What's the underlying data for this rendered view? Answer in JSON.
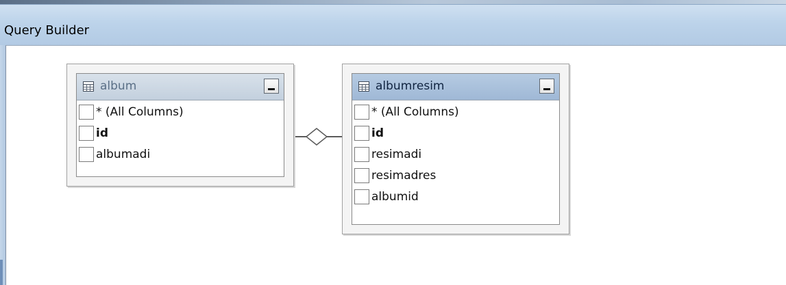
{
  "window": {
    "title": "Query Builder"
  },
  "tables": [
    {
      "name": "album",
      "active": false,
      "columns": [
        {
          "label": "* (All Columns)",
          "key": false,
          "checked": false
        },
        {
          "label": "id",
          "key": true,
          "checked": false
        },
        {
          "label": "albumadi",
          "key": false,
          "checked": false
        }
      ]
    },
    {
      "name": "albumresim",
      "active": true,
      "columns": [
        {
          "label": "* (All Columns)",
          "key": false,
          "checked": false
        },
        {
          "label": "id",
          "key": true,
          "checked": false
        },
        {
          "label": "resimadi",
          "key": false,
          "checked": false
        },
        {
          "label": "resimadres",
          "key": false,
          "checked": false
        },
        {
          "label": "albumid",
          "key": false,
          "checked": false
        }
      ]
    }
  ],
  "icons": {
    "table": "table-grid-icon",
    "minimize": "minimize-icon",
    "relationship": "relationship-diamond-icon"
  },
  "colors": {
    "titlebar": "#bcd3ea",
    "active_header": "#a8bfda",
    "inactive_header": "#cdd8e4"
  }
}
